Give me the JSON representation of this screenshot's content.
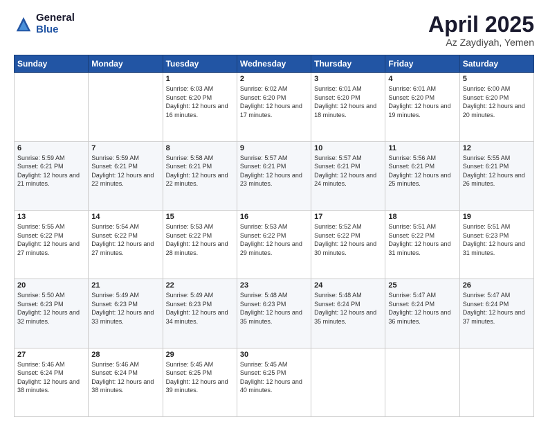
{
  "header": {
    "logo_general": "General",
    "logo_blue": "Blue",
    "month_title": "April 2025",
    "location": "Az Zaydiyah, Yemen"
  },
  "days_of_week": [
    "Sunday",
    "Monday",
    "Tuesday",
    "Wednesday",
    "Thursday",
    "Friday",
    "Saturday"
  ],
  "weeks": [
    [
      {
        "day": "",
        "sunrise": "",
        "sunset": "",
        "daylight": ""
      },
      {
        "day": "",
        "sunrise": "",
        "sunset": "",
        "daylight": ""
      },
      {
        "day": "1",
        "sunrise": "Sunrise: 6:03 AM",
        "sunset": "Sunset: 6:20 PM",
        "daylight": "Daylight: 12 hours and 16 minutes."
      },
      {
        "day": "2",
        "sunrise": "Sunrise: 6:02 AM",
        "sunset": "Sunset: 6:20 PM",
        "daylight": "Daylight: 12 hours and 17 minutes."
      },
      {
        "day": "3",
        "sunrise": "Sunrise: 6:01 AM",
        "sunset": "Sunset: 6:20 PM",
        "daylight": "Daylight: 12 hours and 18 minutes."
      },
      {
        "day": "4",
        "sunrise": "Sunrise: 6:01 AM",
        "sunset": "Sunset: 6:20 PM",
        "daylight": "Daylight: 12 hours and 19 minutes."
      },
      {
        "day": "5",
        "sunrise": "Sunrise: 6:00 AM",
        "sunset": "Sunset: 6:20 PM",
        "daylight": "Daylight: 12 hours and 20 minutes."
      }
    ],
    [
      {
        "day": "6",
        "sunrise": "Sunrise: 5:59 AM",
        "sunset": "Sunset: 6:21 PM",
        "daylight": "Daylight: 12 hours and 21 minutes."
      },
      {
        "day": "7",
        "sunrise": "Sunrise: 5:59 AM",
        "sunset": "Sunset: 6:21 PM",
        "daylight": "Daylight: 12 hours and 22 minutes."
      },
      {
        "day": "8",
        "sunrise": "Sunrise: 5:58 AM",
        "sunset": "Sunset: 6:21 PM",
        "daylight": "Daylight: 12 hours and 22 minutes."
      },
      {
        "day": "9",
        "sunrise": "Sunrise: 5:57 AM",
        "sunset": "Sunset: 6:21 PM",
        "daylight": "Daylight: 12 hours and 23 minutes."
      },
      {
        "day": "10",
        "sunrise": "Sunrise: 5:57 AM",
        "sunset": "Sunset: 6:21 PM",
        "daylight": "Daylight: 12 hours and 24 minutes."
      },
      {
        "day": "11",
        "sunrise": "Sunrise: 5:56 AM",
        "sunset": "Sunset: 6:21 PM",
        "daylight": "Daylight: 12 hours and 25 minutes."
      },
      {
        "day": "12",
        "sunrise": "Sunrise: 5:55 AM",
        "sunset": "Sunset: 6:21 PM",
        "daylight": "Daylight: 12 hours and 26 minutes."
      }
    ],
    [
      {
        "day": "13",
        "sunrise": "Sunrise: 5:55 AM",
        "sunset": "Sunset: 6:22 PM",
        "daylight": "Daylight: 12 hours and 27 minutes."
      },
      {
        "day": "14",
        "sunrise": "Sunrise: 5:54 AM",
        "sunset": "Sunset: 6:22 PM",
        "daylight": "Daylight: 12 hours and 27 minutes."
      },
      {
        "day": "15",
        "sunrise": "Sunrise: 5:53 AM",
        "sunset": "Sunset: 6:22 PM",
        "daylight": "Daylight: 12 hours and 28 minutes."
      },
      {
        "day": "16",
        "sunrise": "Sunrise: 5:53 AM",
        "sunset": "Sunset: 6:22 PM",
        "daylight": "Daylight: 12 hours and 29 minutes."
      },
      {
        "day": "17",
        "sunrise": "Sunrise: 5:52 AM",
        "sunset": "Sunset: 6:22 PM",
        "daylight": "Daylight: 12 hours and 30 minutes."
      },
      {
        "day": "18",
        "sunrise": "Sunrise: 5:51 AM",
        "sunset": "Sunset: 6:22 PM",
        "daylight": "Daylight: 12 hours and 31 minutes."
      },
      {
        "day": "19",
        "sunrise": "Sunrise: 5:51 AM",
        "sunset": "Sunset: 6:23 PM",
        "daylight": "Daylight: 12 hours and 31 minutes."
      }
    ],
    [
      {
        "day": "20",
        "sunrise": "Sunrise: 5:50 AM",
        "sunset": "Sunset: 6:23 PM",
        "daylight": "Daylight: 12 hours and 32 minutes."
      },
      {
        "day": "21",
        "sunrise": "Sunrise: 5:49 AM",
        "sunset": "Sunset: 6:23 PM",
        "daylight": "Daylight: 12 hours and 33 minutes."
      },
      {
        "day": "22",
        "sunrise": "Sunrise: 5:49 AM",
        "sunset": "Sunset: 6:23 PM",
        "daylight": "Daylight: 12 hours and 34 minutes."
      },
      {
        "day": "23",
        "sunrise": "Sunrise: 5:48 AM",
        "sunset": "Sunset: 6:23 PM",
        "daylight": "Daylight: 12 hours and 35 minutes."
      },
      {
        "day": "24",
        "sunrise": "Sunrise: 5:48 AM",
        "sunset": "Sunset: 6:24 PM",
        "daylight": "Daylight: 12 hours and 35 minutes."
      },
      {
        "day": "25",
        "sunrise": "Sunrise: 5:47 AM",
        "sunset": "Sunset: 6:24 PM",
        "daylight": "Daylight: 12 hours and 36 minutes."
      },
      {
        "day": "26",
        "sunrise": "Sunrise: 5:47 AM",
        "sunset": "Sunset: 6:24 PM",
        "daylight": "Daylight: 12 hours and 37 minutes."
      }
    ],
    [
      {
        "day": "27",
        "sunrise": "Sunrise: 5:46 AM",
        "sunset": "Sunset: 6:24 PM",
        "daylight": "Daylight: 12 hours and 38 minutes."
      },
      {
        "day": "28",
        "sunrise": "Sunrise: 5:46 AM",
        "sunset": "Sunset: 6:24 PM",
        "daylight": "Daylight: 12 hours and 38 minutes."
      },
      {
        "day": "29",
        "sunrise": "Sunrise: 5:45 AM",
        "sunset": "Sunset: 6:25 PM",
        "daylight": "Daylight: 12 hours and 39 minutes."
      },
      {
        "day": "30",
        "sunrise": "Sunrise: 5:45 AM",
        "sunset": "Sunset: 6:25 PM",
        "daylight": "Daylight: 12 hours and 40 minutes."
      },
      {
        "day": "",
        "sunrise": "",
        "sunset": "",
        "daylight": ""
      },
      {
        "day": "",
        "sunrise": "",
        "sunset": "",
        "daylight": ""
      },
      {
        "day": "",
        "sunrise": "",
        "sunset": "",
        "daylight": ""
      }
    ]
  ]
}
